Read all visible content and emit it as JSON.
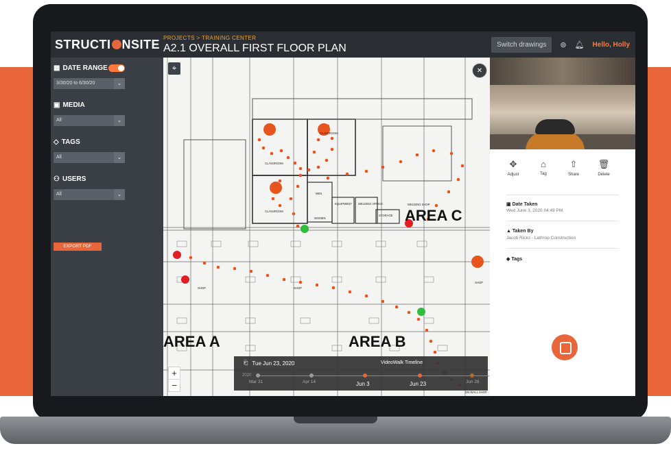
{
  "header": {
    "logo": "STRUCTIONSITE",
    "logo_left": "STRUCTI",
    "logo_right": "NSITE",
    "breadcrumb": "PROJECTS  >  TRAINING CENTER",
    "title": "A2.1 OVERALL FIRST FLOOR PLAN",
    "switch_label": "Switch drawings",
    "help_icon": "help-icon",
    "bell_icon": "bell-icon",
    "greeting": "Hello, Holly"
  },
  "sidebar": {
    "date_range_label": "DATE RANGE",
    "date_range_value": "3/30/20 to 6/30/20",
    "media_label": "MEDIA",
    "media_value": "All",
    "tags_label": "TAGS",
    "tags_value": "All",
    "users_label": "USERS",
    "users_value": "All",
    "export_label": "EXPORT PDF"
  },
  "plan": {
    "areas": [
      "AREA A",
      "AREA B",
      "AREA C"
    ],
    "room_labels": [
      "CLASSROOM",
      "CLASSROOM",
      "CLASSROOM",
      "MEN",
      "WOMEN",
      "EQUIPMENT",
      "WELDING OFFICE",
      "STORAGE",
      "WELDING SHOP",
      "SHOP",
      "SHOP",
      "SHOP",
      "ON-WALL SHOP"
    ],
    "zoom_in": "+",
    "zoom_out": "−"
  },
  "timeline": {
    "current_date": "Tue Jun 23, 2020",
    "title": "VideoWalk Timeline",
    "year": "2020",
    "labels": [
      "Mar 31",
      "Apr 14",
      "Jun 3",
      "Jun 23",
      "Jun 28"
    ]
  },
  "panel": {
    "actions": [
      "Adjust",
      "Tag",
      "Share",
      "Delete"
    ],
    "date_taken_label": "Date Taken",
    "date_taken_value": "Wed June 3, 2020 04:49 PM",
    "taken_by_label": "Taken By",
    "taken_by_value": "Jacob Ricks - Lathrop Construction",
    "tags_label": "Tags"
  },
  "colors": {
    "accent": "#e8663a",
    "path_orange": "#e8541e",
    "green_marker": "#2ebd3c",
    "red_marker": "#e21d24"
  }
}
